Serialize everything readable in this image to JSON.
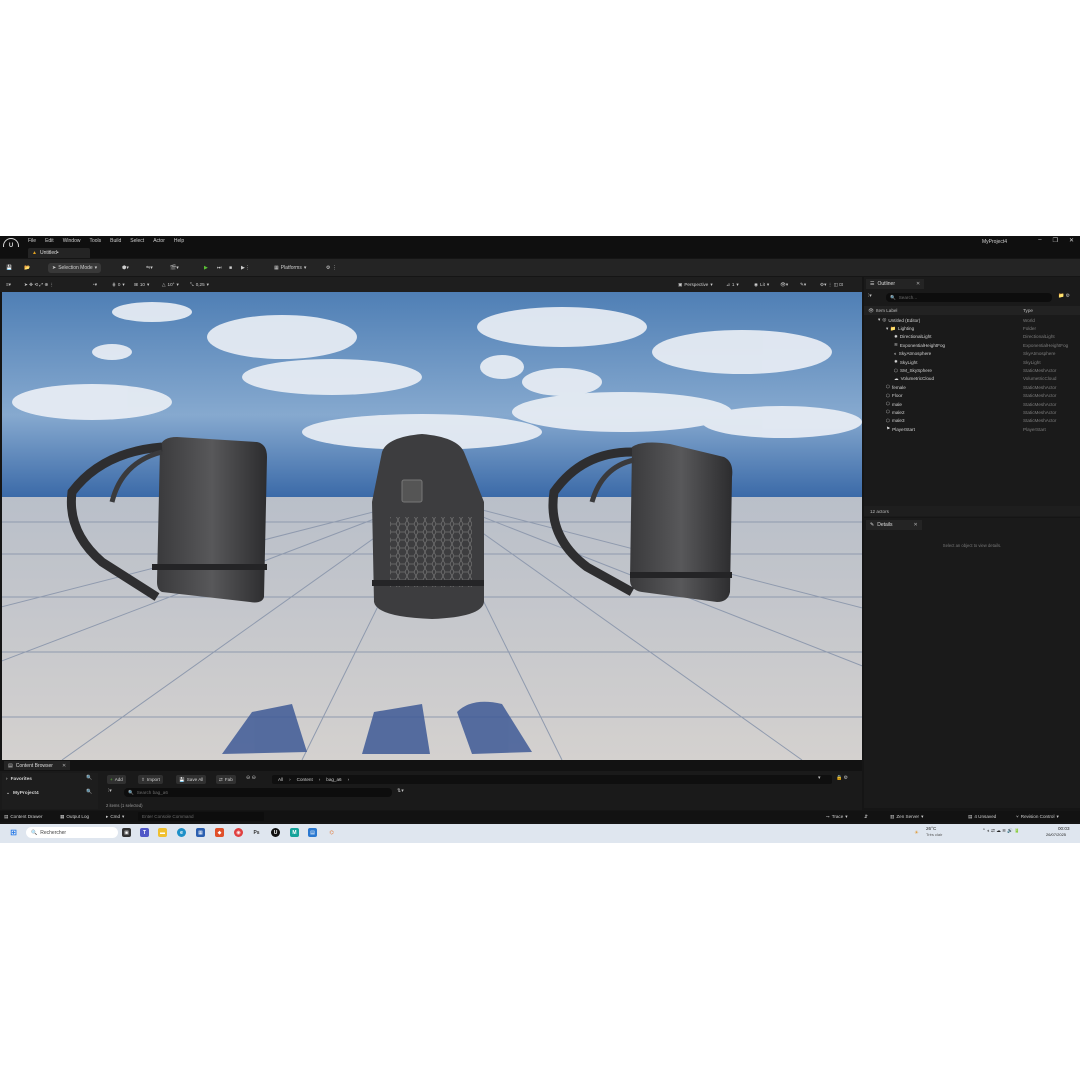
{
  "app": {
    "logo": "U",
    "menu": [
      "File",
      "Edit",
      "Window",
      "Tools",
      "Build",
      "Select",
      "Actor",
      "Help"
    ],
    "project_name": "MyProject4",
    "window_controls": [
      "–",
      "❐",
      "✕"
    ],
    "document_tab": "Untitled•"
  },
  "toolbar": {
    "selection_mode": "Selection Mode",
    "platforms": "Platforms"
  },
  "viewport_toolbar": {
    "snap_translate": "0",
    "snap_location": "10",
    "snap_rotation": "10°",
    "snap_scale": "0,25",
    "view_mode": "Perspective",
    "camera_speed": "1",
    "lit_mode": "Lit"
  },
  "outliner": {
    "tab_label": "Outliner",
    "search_placeholder": "Search...",
    "col_label": "Item Label",
    "col_type": "Type",
    "rows": [
      {
        "label": "Untitled (Editor)",
        "type": "World",
        "indent": 0,
        "icon": "world"
      },
      {
        "label": "Lighting",
        "type": "Folder",
        "indent": 1,
        "icon": "folder"
      },
      {
        "label": "DirectionalLight",
        "type": "DirectionalLight",
        "indent": 2,
        "icon": "light"
      },
      {
        "label": "ExponentialHeightFog",
        "type": "ExponentialHeightFog",
        "indent": 2,
        "icon": "fog"
      },
      {
        "label": "SkyAtmosphere",
        "type": "SkyAtmosphere",
        "indent": 2,
        "icon": "sky"
      },
      {
        "label": "SkyLight",
        "type": "SkyLight",
        "indent": 2,
        "icon": "light"
      },
      {
        "label": "SM_SkySphere",
        "type": "StaticMeshActor",
        "indent": 2,
        "icon": "mesh"
      },
      {
        "label": "VolumetricCloud",
        "type": "VolumetricCloud",
        "indent": 2,
        "icon": "cloud"
      },
      {
        "label": "female",
        "type": "StaticMeshActor",
        "indent": 1,
        "icon": "mesh"
      },
      {
        "label": "Floor",
        "type": "StaticMeshActor",
        "indent": 1,
        "icon": "mesh"
      },
      {
        "label": "male",
        "type": "StaticMeshActor",
        "indent": 1,
        "icon": "mesh"
      },
      {
        "label": "male2",
        "type": "StaticMeshActor",
        "indent": 1,
        "icon": "mesh"
      },
      {
        "label": "male3",
        "type": "StaticMeshActor",
        "indent": 1,
        "icon": "mesh"
      },
      {
        "label": "PlayerStart",
        "type": "PlayerStart",
        "indent": 1,
        "icon": "player"
      }
    ],
    "actors_count": "12 actors"
  },
  "details": {
    "tab_label": "Details",
    "empty_message": "Select an object to view details."
  },
  "content_browser": {
    "tab_label": "Content Browser",
    "favorites": "Favorites",
    "project": "MyProject4",
    "add": "Add",
    "import": "Import",
    "save_all": "Save All",
    "fab": "Fab",
    "breadcrumbs": [
      "All",
      "Content",
      "bag_a6"
    ],
    "search_placeholder": "Search bag_a6",
    "items_text": "2 items (1 selected)"
  },
  "statusbar": {
    "content_drawer": "Content Drawer",
    "output_log": "Output Log",
    "cmd": "Cmd",
    "console_placeholder": "Enter Console Command",
    "trace": "Trace",
    "zen_server": "Zen Server",
    "unsaved": "4 Unsaved",
    "revision_control": "Revision Control"
  },
  "taskbar": {
    "search": "Rechercher",
    "temperature": "26°C",
    "weather": "Très clair",
    "time": "00:03",
    "date": "26/07/2025"
  }
}
